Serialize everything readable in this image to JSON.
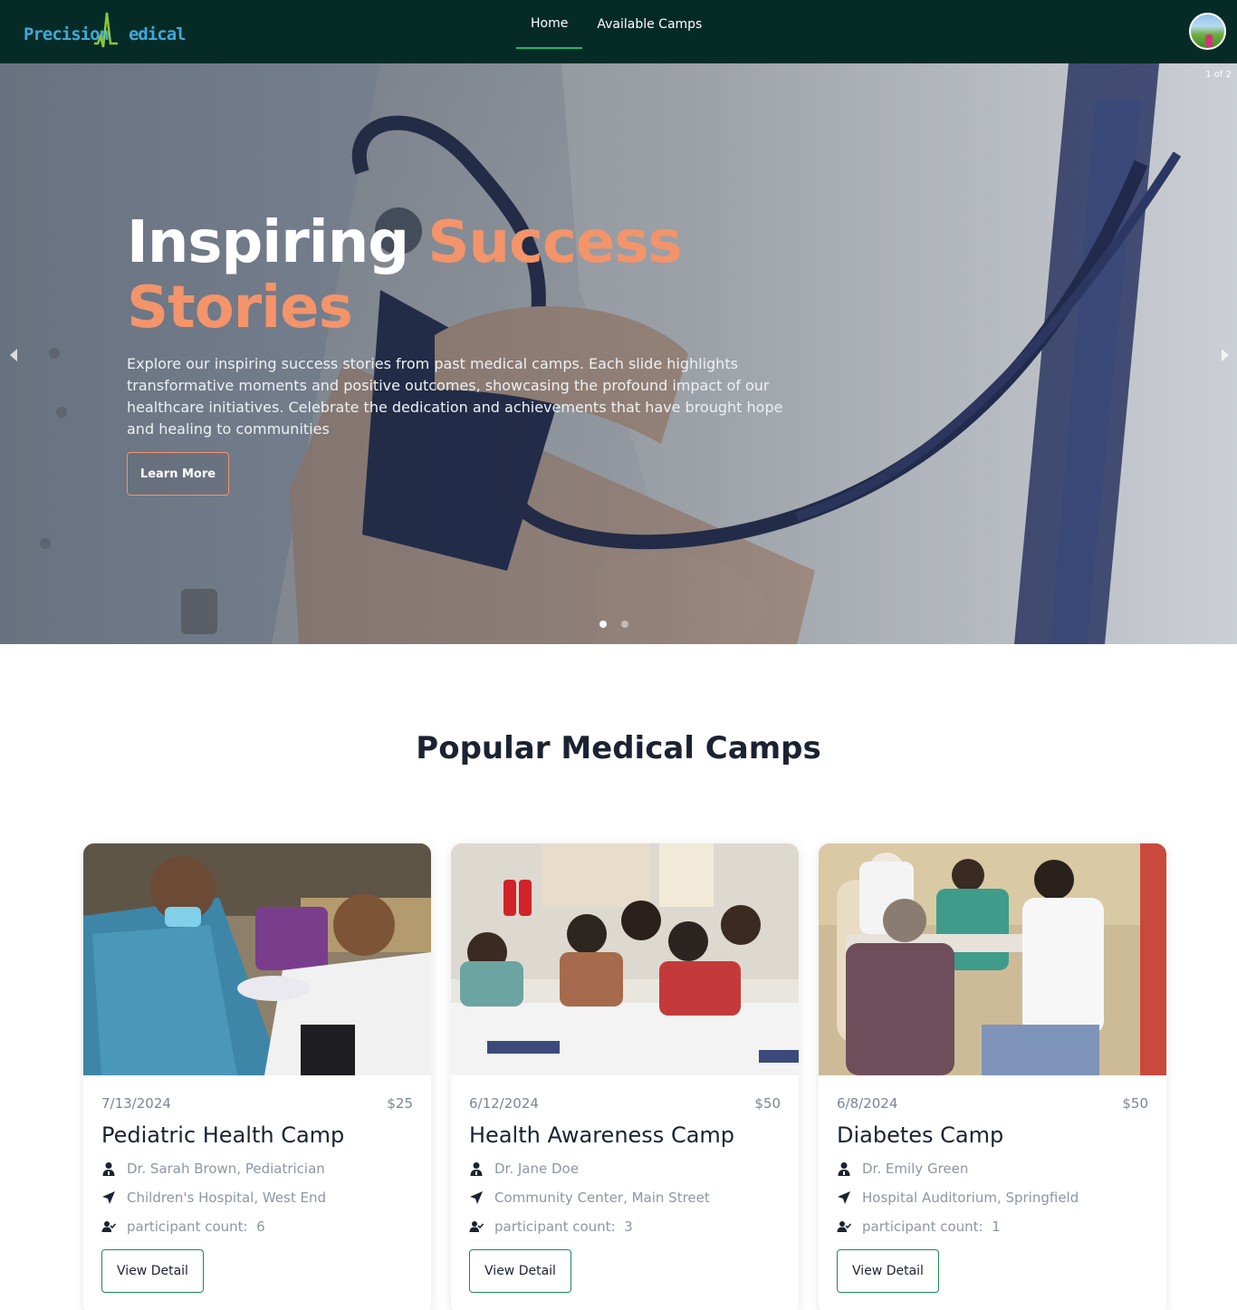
{
  "brand": {
    "logo_part1": "Precision",
    "logo_part2": "edical"
  },
  "nav": {
    "items": [
      {
        "label": "Home"
      },
      {
        "label": "Available Camps"
      }
    ]
  },
  "hero": {
    "slide_counter": "1 of 2",
    "title_white": "Inspiring",
    "title_orange_1": "Success",
    "title_orange_2": "Stories",
    "description": "Explore our inspiring success stories from past medical camps. Each slide highlights transformative moments and positive outcomes, showcasing the profound impact of our healthcare initiatives. Celebrate the dedication and achievements that have brought hope and healing to communities",
    "button_label": "Learn More",
    "total_slides": 2,
    "active_slide": 1
  },
  "section": {
    "title": "Popular Medical Camps"
  },
  "camps": [
    {
      "date": "7/13/2024",
      "price": "$25",
      "name": "Pediatric Health Camp",
      "doctor": "Dr. Sarah Brown, Pediatrician",
      "location": "Children's Hospital, West End",
      "participant_label": "participant count:",
      "participant_count": "6",
      "button_label": "View Detail"
    },
    {
      "date": "6/12/2024",
      "price": "$50",
      "name": "Health Awareness Camp",
      "doctor": "Dr. Jane Doe",
      "location": "Community Center, Main Street",
      "participant_label": "participant count:",
      "participant_count": "3",
      "button_label": "View Detail"
    },
    {
      "date": "6/8/2024",
      "price": "$50",
      "name": "Diabetes Camp",
      "doctor": "Dr. Emily Green",
      "location": "Hospital Auditorium, Springfield",
      "participant_label": "participant count:",
      "participant_count": "1",
      "button_label": "View Detail"
    }
  ],
  "colors": {
    "navbar": "#062b27",
    "accent_orange": "#f3946b",
    "accent_green": "#22b573",
    "button_border": "#1c8a5a"
  }
}
